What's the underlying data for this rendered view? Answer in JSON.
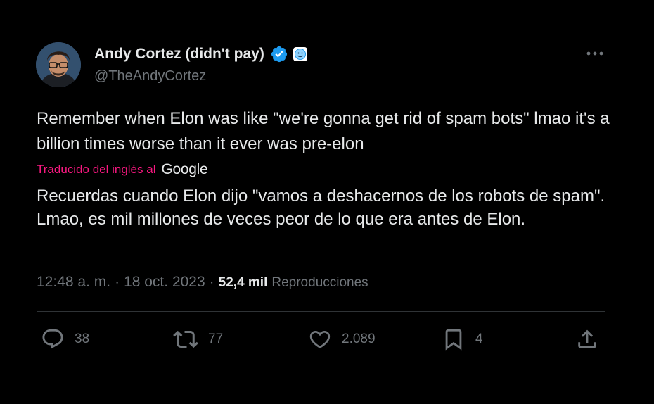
{
  "author": {
    "display_name": "Andy Cortez (didn't pay)",
    "handle": "@TheAndyCortez",
    "avatar_icon": "avatar-photo",
    "verified_icon": "verified-badge-icon",
    "verified_color": "#1d9bf0"
  },
  "tweet": {
    "text": "Remember when Elon was like \"we're gonna get rid of spam bots\" lmao it's a billion times worse than it ever was pre-elon",
    "translated_label": "Traducido del inglés al",
    "translator_brand": "Google",
    "translation": "Recuerdas cuando Elon dijo \"vamos a deshacernos de los robots de spam\". Lmao, es mil millones de veces peor de lo que era antes de Elon."
  },
  "meta": {
    "time": "12:48 a. m.",
    "separator": "·",
    "date": "18 oct. 2023",
    "views_count": "52,4 mil",
    "views_label": "Reproducciones"
  },
  "actions": {
    "replies": "38",
    "reposts": "77",
    "likes": "2.089",
    "bookmarks": "4"
  },
  "colors": {
    "background": "#000000",
    "text": "#e7e9ea",
    "muted": "#71767b",
    "accent_pink": "#f91880",
    "divider": "#2f3336"
  }
}
